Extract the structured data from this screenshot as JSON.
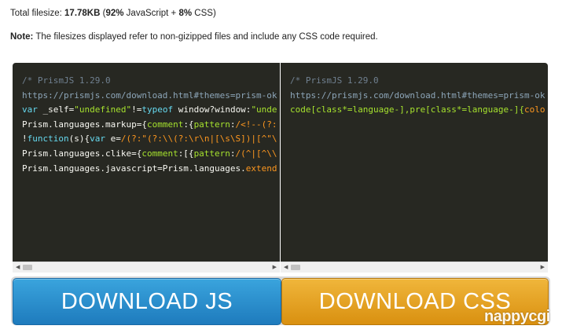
{
  "filesize": {
    "prefix": "Total filesize: ",
    "size": "17.78KB",
    "open_paren": " (",
    "js_pct": "92%",
    "js_label": " JavaScript + ",
    "css_pct": "8%",
    "css_label": " CSS)"
  },
  "note": {
    "label": "Note:",
    "text": " The filesizes displayed refer to non-gizipped files and include any CSS code required."
  },
  "js_panel": {
    "lines": [
      [
        {
          "c": "comment",
          "t": "/* PrismJS 1.29.0"
        }
      ],
      [
        {
          "c": "url",
          "t": "https://prismjs.com/download.html#themes=prism-ok"
        }
      ],
      [
        {
          "c": "kw",
          "t": "var"
        },
        {
          "c": "plain",
          "t": " _self="
        },
        {
          "c": "str",
          "t": "\"undefined\""
        },
        {
          "c": "plain",
          "t": "!="
        },
        {
          "c": "kw",
          "t": "typeof"
        },
        {
          "c": "plain",
          "t": " window?window:"
        },
        {
          "c": "str",
          "t": "\"unde"
        }
      ],
      [
        {
          "c": "plain",
          "t": "Prism.languages.markup={"
        },
        {
          "c": "str",
          "t": "comment"
        },
        {
          "c": "plain",
          "t": ":{"
        },
        {
          "c": "str",
          "t": "pattern"
        },
        {
          "c": "plain",
          "t": ":"
        },
        {
          "c": "rx",
          "t": "/<!--(?:"
        }
      ],
      [
        {
          "c": "plain",
          "t": "!"
        },
        {
          "c": "kw",
          "t": "function"
        },
        {
          "c": "plain",
          "t": "(s){"
        },
        {
          "c": "kw",
          "t": "var"
        },
        {
          "c": "plain",
          "t": " e="
        },
        {
          "c": "rx",
          "t": "/(?:\"(?:\\\\(?:\\r\\n|[\\s\\S])|[^\"\\"
        }
      ],
      [
        {
          "c": "plain",
          "t": "Prism.languages.clike={"
        },
        {
          "c": "str",
          "t": "comment"
        },
        {
          "c": "plain",
          "t": ":[{"
        },
        {
          "c": "str",
          "t": "pattern"
        },
        {
          "c": "plain",
          "t": ":"
        },
        {
          "c": "rx",
          "t": "/(^|[^\\\\"
        }
      ],
      [
        {
          "c": "plain",
          "t": "Prism.languages.javascript=Prism.languages."
        },
        {
          "c": "rx",
          "t": "extend"
        }
      ]
    ]
  },
  "css_panel": {
    "lines": [
      [
        {
          "c": "comment",
          "t": "/* PrismJS 1.29.0"
        }
      ],
      [
        {
          "c": "url",
          "t": "https://prismjs.com/download.html#themes=prism-ok"
        }
      ],
      [
        {
          "c": "str",
          "t": "code[class*=language-],pre[class*=language-]{"
        },
        {
          "c": "rx",
          "t": "colo"
        }
      ]
    ]
  },
  "buttons": {
    "download_js": "DOWNLOAD JS",
    "download_css": "DOWNLOAD CSS"
  },
  "scrollbar": {
    "left_arrow": "◀",
    "right_arrow": "▶"
  },
  "watermark": "nappycgi",
  "colors": {
    "code_bg": "#272822",
    "js_button": "#2a8fd0",
    "css_button": "#e6a222"
  }
}
